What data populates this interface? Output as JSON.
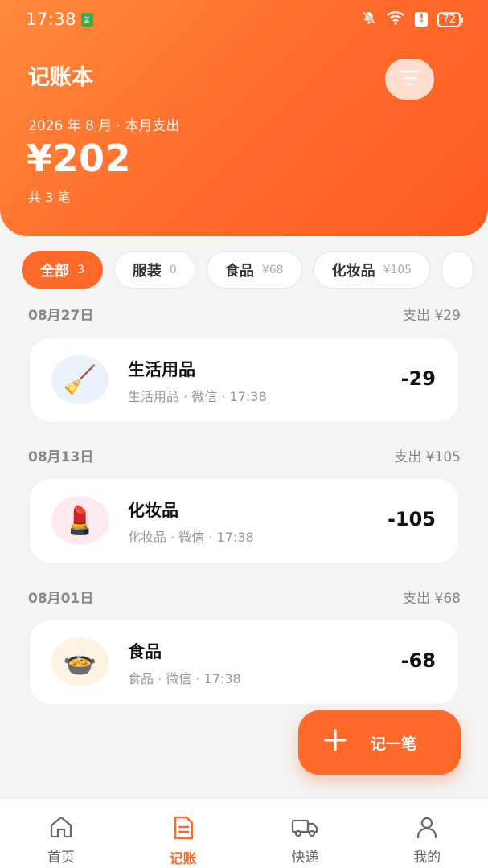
{
  "status_bar": {
    "time": "17:38",
    "battery": "72"
  },
  "header": {
    "title": "记账本",
    "month_line": "2026 年 8 月 · 本月支出",
    "total": "¥202",
    "count": "共 3 笔"
  },
  "chips": [
    {
      "label": "全部",
      "sub": "3",
      "active": true
    },
    {
      "label": "服装",
      "sub": "0"
    },
    {
      "label": "食品",
      "sub": "¥68"
    },
    {
      "label": "化妆品",
      "sub": "¥105"
    }
  ],
  "groups": [
    {
      "date": "08月27日",
      "total": "支出 ¥29",
      "item": {
        "title": "生活用品",
        "meta": "生活用品 · 微信 · 17:38",
        "amount": "-29",
        "icon": "broom-icon",
        "icon_glyph": "🧹",
        "icon_bg": "#e9f2fd"
      }
    },
    {
      "date": "08月13日",
      "total": "支出 ¥105",
      "item": {
        "title": "化妆品",
        "meta": "化妆品 · 微信 · 17:38",
        "amount": "-105",
        "icon": "lipstick-icon",
        "icon_glyph": "💄",
        "icon_bg": "#fde9ee"
      }
    },
    {
      "date": "08月01日",
      "total": "支出 ¥68",
      "item": {
        "title": "食品",
        "meta": "食品 · 微信 · 17:38",
        "amount": "-68",
        "icon": "food-bowl-icon",
        "icon_glyph": "🍲",
        "icon_bg": "#fdf3e3"
      }
    }
  ],
  "fab": {
    "label": "记一笔",
    "icon": "plus-icon"
  },
  "tabbar": [
    {
      "label": "首页",
      "icon": "home-icon"
    },
    {
      "label": "记账",
      "icon": "ledger-icon",
      "active": true
    },
    {
      "label": "快递",
      "icon": "truck-icon"
    },
    {
      "label": "我的",
      "icon": "person-icon"
    }
  ],
  "colors": {
    "accent": "#ff6a2a",
    "background": "#f4f4f4"
  }
}
